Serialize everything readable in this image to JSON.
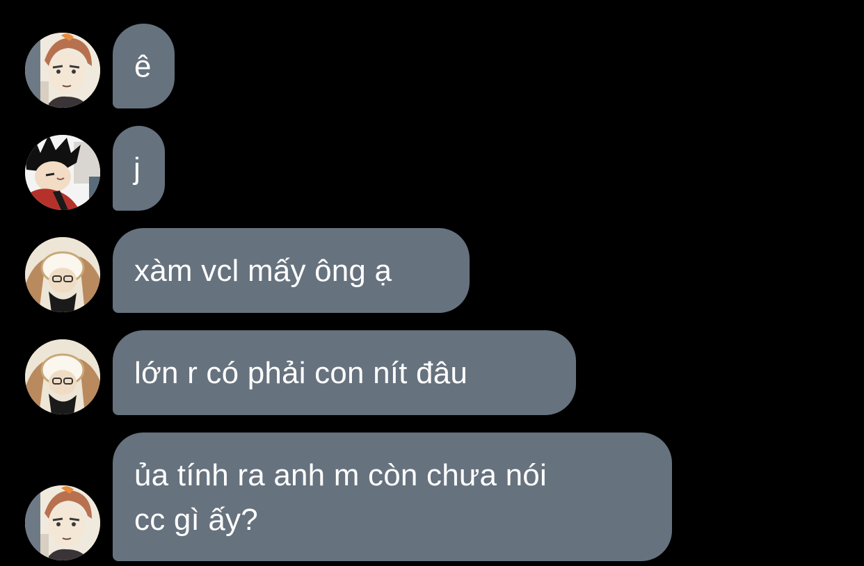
{
  "conversation": {
    "messages": [
      {
        "text": "ê",
        "avatar": "avatar-icon-red-haired-character"
      },
      {
        "text": "j",
        "avatar": "avatar-icon-black-haired-character"
      },
      {
        "text": "xàm vcl mấy ông ạ",
        "avatar": "avatar-icon-glasses-character"
      },
      {
        "text": "lớn r có phải con nít đâu",
        "avatar": "avatar-icon-glasses-character"
      },
      {
        "text": "ủa tính ra anh m còn chưa nói\ncc gì ấy?",
        "avatar": "avatar-icon-red-haired-character"
      }
    ]
  },
  "colors": {
    "background": "#000000",
    "bubble": "#66727e",
    "text": "#ffffff"
  }
}
